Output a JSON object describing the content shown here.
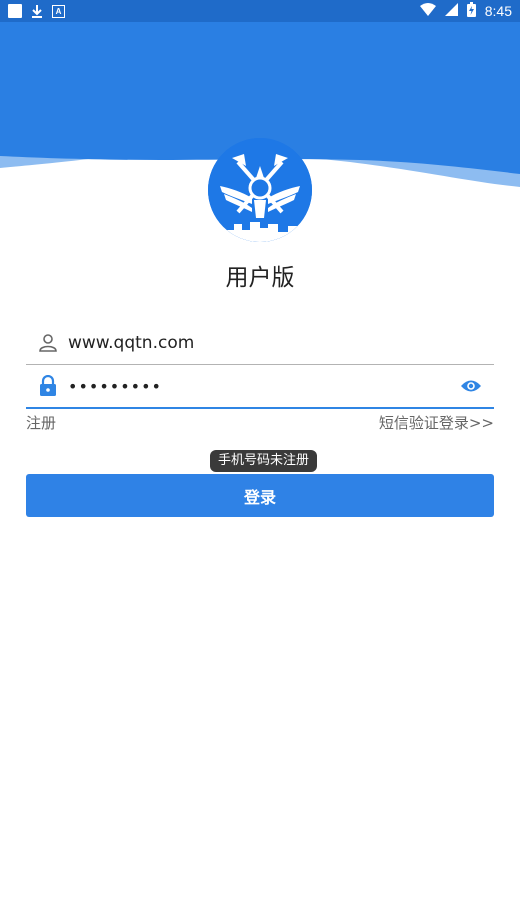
{
  "status_bar": {
    "time": "8:45",
    "icons": [
      "notification-square-icon",
      "download-icon",
      "a-badge-icon",
      "wifi-icon",
      "signal-icon",
      "battery-icon"
    ]
  },
  "colors": {
    "primary": "#2f82e6",
    "status_bar": "#1f6bc9",
    "header_dark": "#2a7fe3",
    "header_light": "#8dbcf1"
  },
  "app": {
    "title": "用户版",
    "logo_icon": "fire-emblem-icon"
  },
  "form": {
    "username_value": "www.qqtn.com",
    "password_value": "•••••••••",
    "user_icon": "person-icon",
    "lock_icon": "lock-icon",
    "show_password_icon": "eye-icon"
  },
  "links": {
    "register": "注册",
    "sms_login": "短信验证登录>>"
  },
  "toast": {
    "message": "手机号码未注册"
  },
  "buttons": {
    "login": "登录"
  }
}
